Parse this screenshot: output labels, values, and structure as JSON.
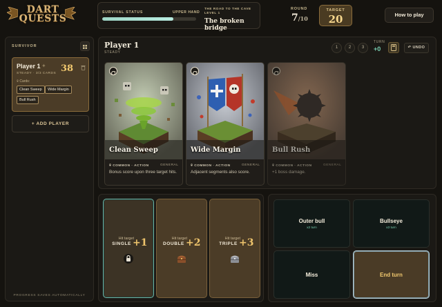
{
  "header": {
    "logo": {
      "line1": "DART",
      "line2": "QUESTS"
    },
    "survival": {
      "label": "SURVIVAL STATUS",
      "hand": "UPPER HAND",
      "progress": 0.76
    },
    "road": {
      "label_line1": "THE ROAD TO THE CAVE",
      "label_line2": "LEVEL 1",
      "title": "The broken bridge"
    },
    "round": {
      "label": "ROUND",
      "value": "7",
      "total": "/10"
    },
    "target": {
      "label": "TARGET",
      "value": "20"
    },
    "how_to_play": "How to play"
  },
  "sidebar": {
    "title": "SURVIVOR",
    "player": {
      "name": "Player 1",
      "subtitle": "STEADY · 3/3 CARDS",
      "score": "38",
      "cards_label": "Cards:",
      "chips": [
        "Clean Sweep",
        "Wide Margin",
        "Bull Rush"
      ]
    },
    "add_player": "+ ADD PLAYER",
    "footer": "PROGRESS SAVES AUTOMATICALLY"
  },
  "main": {
    "player_name": "Player 1",
    "player_style": "STEADY",
    "pages": [
      "1",
      "2",
      "3"
    ],
    "turn": {
      "label": "TURN",
      "value": "+0"
    },
    "undo": "↶ UNDO",
    "cards": [
      {
        "title": "Clean Sweep",
        "kind": "COMMON · ACTION",
        "category": "GENERAL",
        "desc": "Bonus score upon three target hits.",
        "dim": false
      },
      {
        "title": "Wide Margin",
        "kind": "COMMON · ACTION",
        "category": "GENERAL",
        "desc": "Adjacent segments also score.",
        "dim": false
      },
      {
        "title": "Bull Rush",
        "kind": "COMMON · ACTION",
        "category": "GENERAL",
        "desc": "+1 boss damage.",
        "dim": true
      }
    ]
  },
  "hits": [
    {
      "pre": "Hit target",
      "type": "SINGLE",
      "mult": "+1",
      "icon": "lock-icon",
      "selected": true
    },
    {
      "pre": "Hit target",
      "type": "DOUBLE",
      "mult": "+2",
      "icon": "chest-icon",
      "selected": false
    },
    {
      "pre": "Hit target",
      "type": "TRIPLE",
      "mult": "+3",
      "icon": "silver-chest-icon",
      "selected": false
    }
  ],
  "actions": {
    "outer_bull": {
      "name": "Outer bull",
      "sub": "x2 turn"
    },
    "bullseye": {
      "name": "Bullseye",
      "sub": "x3 turn"
    },
    "miss": {
      "name": "Miss"
    },
    "end_turn": {
      "name": "End turn"
    }
  }
}
